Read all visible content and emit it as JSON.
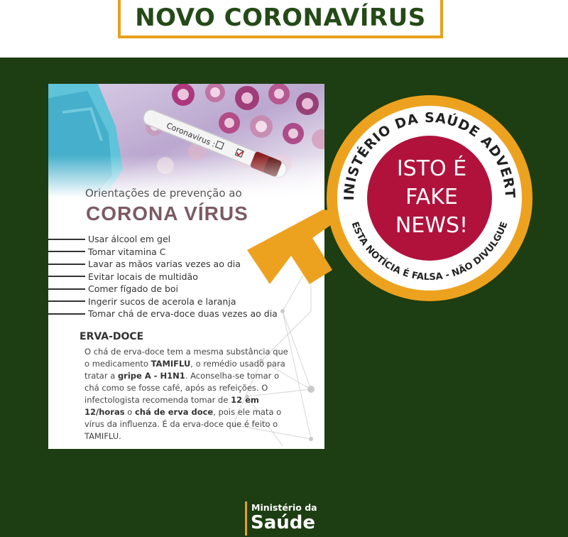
{
  "header": {
    "title": "NOVO CORONAVÍRUS"
  },
  "post": {
    "tube_label": "Coronavirus :",
    "subtitle": "Orientações de prevenção ao",
    "heading": "CORONA VÍRUS",
    "tips": [
      "Usar álcool em gel",
      "Tomar vitamina C",
      "Lavar as mãos varias vezes ao dia",
      "Evitar locais de multidão",
      "Comer fígado de boi",
      "Ingerir sucos de acerola e laranja",
      "Tomar chá de erva-doce duas vezes ao dia"
    ],
    "erva": {
      "title": "ERVA-DOCE",
      "p1": "O chá de erva-doce tem a mesma substância que o medicamento ",
      "b1": "TAMIFLU",
      "p2": ", o remédio usado para tratar a ",
      "b2": "gripe A - H1N1",
      "p3": ". Aconselha-se tomar o chá como se fosse café, após as  refeições. O infectologista recomenda tomar de ",
      "b3": "12 em 12/horas",
      "p4": " o ",
      "b4": "chá de erva doce",
      "p5": ", pois ele mata o vírus da influenza. É da erva-doce que é feito  o TAMIFLU."
    }
  },
  "badge": {
    "top_text": "MINISTÉRIO DA SAÚDE ADVERTE:",
    "bottom_text": "ESTA NOTÍCIA É FALSA - NÃO DIVULGUE",
    "line1": "ISTO É",
    "line2": "FAKE",
    "line3": "NEWS!"
  },
  "footer": {
    "logo_small": "Ministério da",
    "logo_big": "Saúde"
  },
  "colors": {
    "green": "#1d3d12",
    "orange": "#e8a11c",
    "red": "#b0123c",
    "title_green": "#244a17"
  }
}
